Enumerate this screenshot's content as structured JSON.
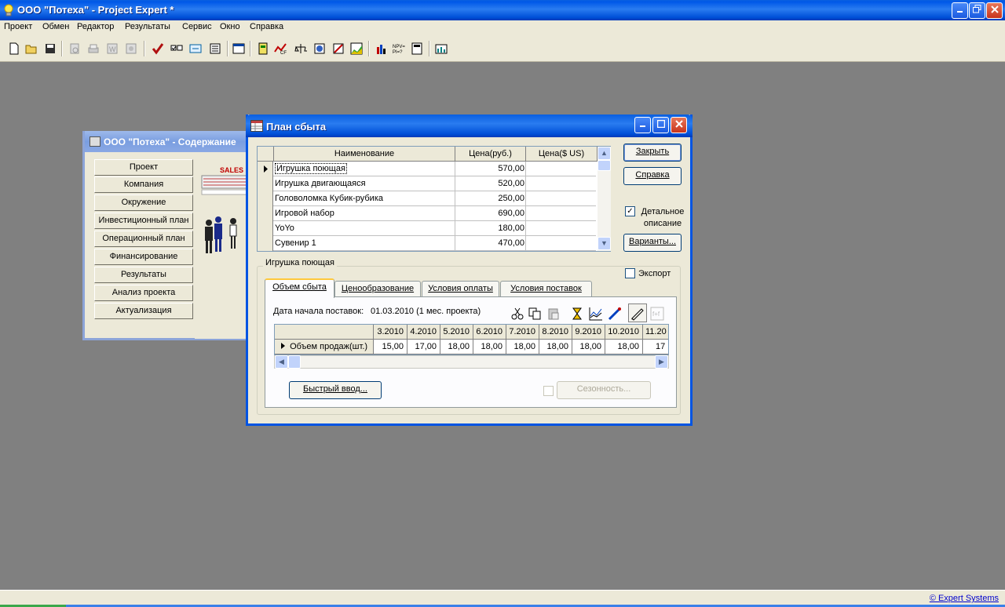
{
  "app": {
    "title": "ООО \"Потеха\" - Project Expert *",
    "menu": [
      "Проект",
      "Обмен",
      "Редактор",
      "Результаты",
      "Сервис",
      "Окно",
      "Справка"
    ],
    "copyright": "© Expert Systems"
  },
  "contents_window": {
    "title": "ООО \"Потеха\" - Содержание",
    "nav": [
      "Проект",
      "Компания",
      "Окружение",
      "Инвестиционный план",
      "Операционный план",
      "Финансирование",
      "Результаты",
      "Анализ проекта",
      "Актуализация"
    ],
    "logo_text": "SALES"
  },
  "dialog": {
    "title": "План сбыта",
    "columns": [
      "Наименование",
      "Цена(руб.)",
      "Цена($ US)"
    ],
    "products": [
      {
        "name": "Игрушка поющая",
        "price_rub": "570,00",
        "price_usd": ""
      },
      {
        "name": "Игрушка двигающаяся",
        "price_rub": "520,00",
        "price_usd": ""
      },
      {
        "name": "Головоломка Кубик-рубика",
        "price_rub": "250,00",
        "price_usd": ""
      },
      {
        "name": "Игровой набор",
        "price_rub": "690,00",
        "price_usd": ""
      },
      {
        "name": "YoYo",
        "price_rub": "180,00",
        "price_usd": ""
      },
      {
        "name": "Сувенир 1",
        "price_rub": "470,00",
        "price_usd": ""
      }
    ],
    "buttons": {
      "close": "Закрыть",
      "help": "Справка",
      "detail": "Детальное описание",
      "detail_line1": "Детальное",
      "detail_line2": "описание",
      "variants": "Варианты...",
      "quick": "Быстрый ввод...",
      "season": "Сезонность..."
    },
    "export_label": "Экспорт",
    "group_title": "Игрушка поющая",
    "tabs": [
      "Объем сбыта",
      "Ценообразование",
      "Условия оплаты",
      "Условия поставок"
    ],
    "start_label": "Дата начала поставок:",
    "start_value": "01.03.2010 (1 мес. проекта)",
    "period_headers": [
      "3.2010",
      "4.2010",
      "5.2010",
      "6.2010",
      "7.2010",
      "8.2010",
      "9.2010",
      "10.2010",
      "11.20"
    ],
    "row_label": "Объем продаж(шт.)",
    "row_values": [
      "15,00",
      "17,00",
      "18,00",
      "18,00",
      "18,00",
      "18,00",
      "18,00",
      "18,00",
      "17"
    ]
  }
}
